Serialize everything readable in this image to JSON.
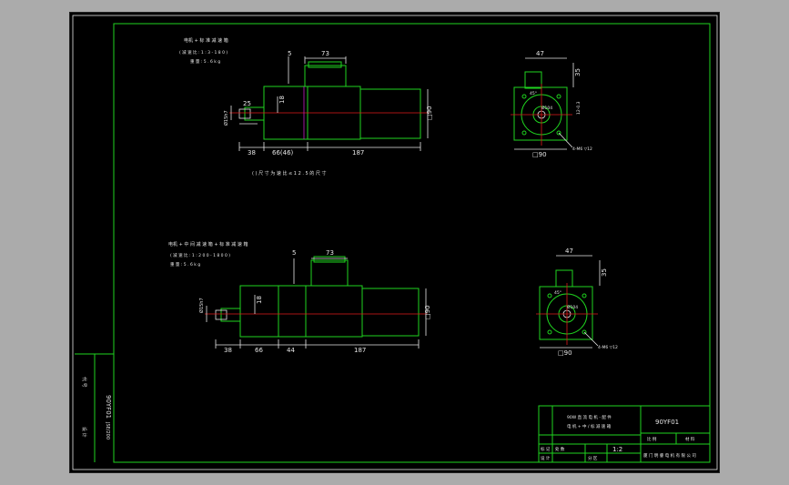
{
  "drawing": {
    "top_view": {
      "title": "电机 + 标 准 减 速 箱",
      "ratio": "( 减 速 比 : 1 : 3 - 1 8 0 )",
      "weight": "重 量   : 5 . 6 k g",
      "note": "( ) 尺 寸 为 速 比 ≤ 1 2 . 5 的 尺 寸",
      "dims": {
        "d5": "5",
        "d73": "73",
        "d25": "25",
        "d18": "18",
        "d15": "Ø15h7",
        "d38": "38",
        "d66": "66(46)",
        "d187": "187",
        "d90": "□90"
      },
      "side": {
        "d47": "47",
        "d35": "35",
        "d12": "12-0.3",
        "d104": "Ø104",
        "d90": "□90",
        "bolt": "4-M6 ▽12",
        "angle": "45°"
      }
    },
    "bottom_view": {
      "title": "电机 + 中 间 减 速 箱 + 标 准 减 速 箱",
      "ratio": "( 减 速 比 : 1 : 2 0 0 - 1 8 0 0 )",
      "weight": "重 量   : 5 . 6 k g",
      "dims": {
        "d5": "5",
        "d73": "73",
        "d18": "18",
        "d15": "Ø15h7",
        "d38": "38",
        "d66": "66",
        "d44": "44",
        "d187": "187",
        "d90": "□90"
      },
      "side": {
        "d47": "47",
        "d35": "35",
        "d104": "Ø104",
        "d90": "□90",
        "bolt": "4-M6 ▽12",
        "angle": "45°"
      }
    },
    "title_block": {
      "line1": "90W 直 流 电 机 - 配 件",
      "line2": "电 机 + 中 / 标 减 速 箱",
      "drawing_no": "90YF01",
      "scale_label": "比 例",
      "material_label": "材 料",
      "scale": "1:2",
      "row1": "标 记",
      "row2": "设 计",
      "row3": "审 核",
      "row4": "日 期",
      "qty": "处 数",
      "sign": "分 区",
      "company": "厦 门 明 睿 电 机 有 限 公 司"
    },
    "side_strip": {
      "code": "90YF01",
      "date": "JSE/200",
      "label_a": "代 号",
      "label_b": "设 计"
    }
  }
}
